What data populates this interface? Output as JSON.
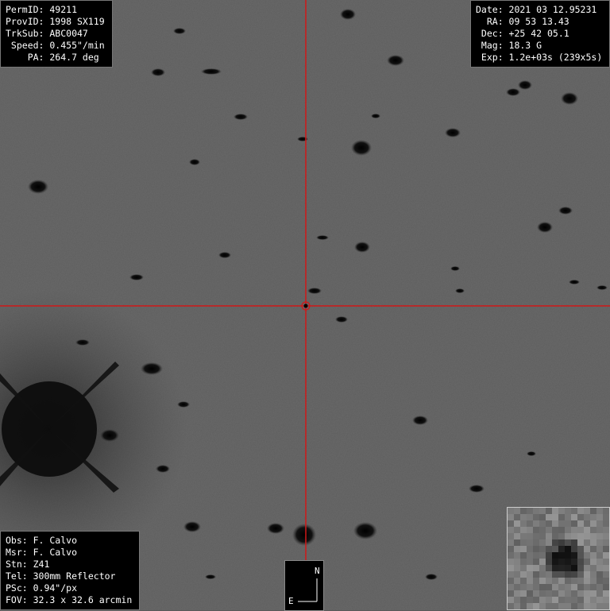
{
  "top_left": {
    "permid": "PermID: 49211",
    "provid": "ProvID: 1998 SX119",
    "trksub": "TrkSub: ABC0047",
    "speed": " Speed: 0.455\"/min",
    "pa": "    PA: 264.7 deg"
  },
  "top_right": {
    "date": "Date: 2021 03 12.95231",
    "ra": "  RA: 09 53 13.43",
    "dec": " Dec: +25 42 05.1",
    "mag": " Mag: 18.3 G",
    "exp": " Exp: 1.2e+03s (239x5s)"
  },
  "bottom_left": {
    "obs": "Obs: F. Calvo",
    "msr": "Msr: F. Calvo",
    "stn": "Stn: Z41",
    "tel": "Tel: 300mm Reflector",
    "psc": "PSc: 0.94\"/px",
    "fov": "FOV: 32.3 x 32.6 arcmin"
  },
  "compass": {
    "north": "N",
    "east": "E"
  },
  "colors": {
    "crosshair": "#d01818",
    "sky": "#5a5a5a",
    "star": "#0a0a0a"
  }
}
